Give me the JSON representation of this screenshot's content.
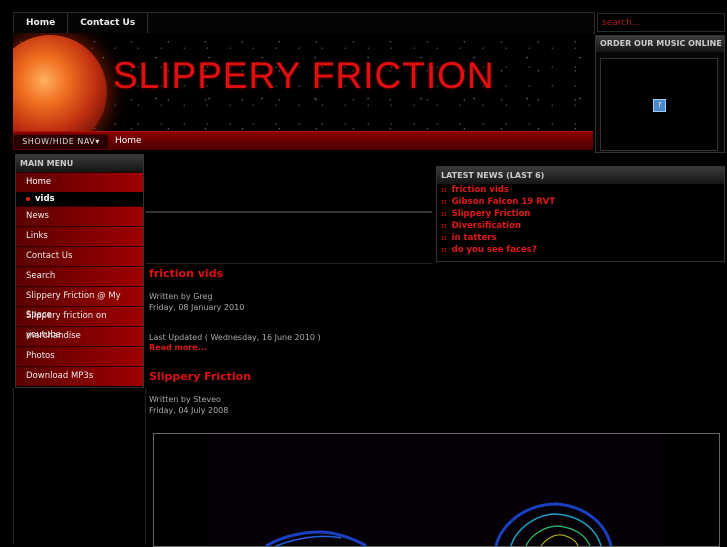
{
  "top_nav": {
    "items": [
      "Home",
      "Contact Us"
    ]
  },
  "search": {
    "placeholder": "search..."
  },
  "header": {
    "title": "SLIPPERY FRICTION"
  },
  "navbar": {
    "toggle_label": "SHOW/HIDE NAV▾",
    "breadcrumb": "Home"
  },
  "order_box": {
    "title": "ORDER OUR MUSIC ONLINE",
    "icon": "?"
  },
  "main_menu": {
    "title": "MAIN MENU",
    "items": [
      "Home",
      "vids",
      "News",
      "Links",
      "Contact Us",
      "Search",
      "Slippery Friction @ My Space",
      "Slippery friction on youtube",
      "merchandise",
      "Photos",
      "Download MP3s"
    ]
  },
  "latest_news": {
    "title": "LATEST NEWS (LAST 6)",
    "items": [
      "friction vids",
      "Gibson Falcon 19 RVT",
      "Slippery Friction",
      "Diversification",
      "in tatters",
      "do you see faces?"
    ]
  },
  "articles": [
    {
      "title": "friction vids",
      "author": "Written by Greg",
      "date": "Friday, 08 January 2010",
      "updated": "Last Updated ( Wednesday, 16 June 2010 )",
      "read_more": "Read more..."
    },
    {
      "title": "Slippery Friction",
      "author": "Written by Steveo",
      "date": "Friday, 04 July 2008"
    }
  ]
}
